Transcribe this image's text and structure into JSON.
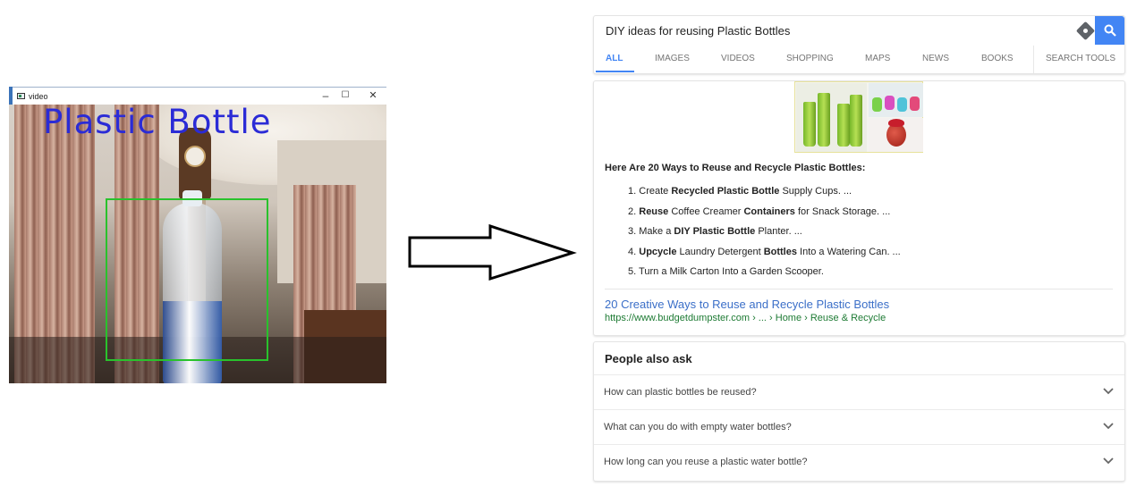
{
  "video_window": {
    "title": "video",
    "detection_label": "Plastic Bottle",
    "controls": {
      "minimize": "–",
      "maximize": "☐",
      "close": "✕"
    }
  },
  "search": {
    "query": "DIY ideas for reusing Plastic Bottles",
    "tabs": [
      {
        "label": "ALL",
        "active": true
      },
      {
        "label": "IMAGES"
      },
      {
        "label": "VIDEOS"
      },
      {
        "label": "SHOPPING"
      },
      {
        "label": "MAPS"
      },
      {
        "label": "NEWS"
      },
      {
        "label": "BOOKS"
      },
      {
        "label": "SEARCH TOOLS"
      }
    ]
  },
  "answer": {
    "heading": "Here Are 20 Ways to Reuse and Recycle Plastic Bottles:",
    "items": [
      {
        "n": "1.",
        "parts": [
          "Create ",
          "Recycled Plastic Bottle",
          " Supply Cups. ..."
        ]
      },
      {
        "n": "2.",
        "parts": [
          "",
          "Reuse",
          " Coffee Creamer ",
          "Containers",
          " for Snack Storage. ..."
        ]
      },
      {
        "n": "3.",
        "parts": [
          "Make a ",
          "DIY Plastic Bottle",
          " Planter. ..."
        ]
      },
      {
        "n": "4.",
        "parts": [
          "",
          "Upcycle",
          " Laundry Detergent ",
          "Bottles",
          " Into a Watering Can. ..."
        ]
      },
      {
        "n": "5.",
        "parts": [
          "Turn a Milk Carton Into a Garden Scooper."
        ]
      }
    ],
    "result_title": "20 Creative Ways to Reuse and Recycle Plastic Bottles",
    "result_url": "https://www.budgetdumpster.com › ... › Home › Reuse & Recycle"
  },
  "people_also_ask": {
    "title": "People also ask",
    "questions": [
      "How can plastic bottles be reused?",
      "What can you do with empty water bottles?",
      "How long can you reuse a plastic water bottle?"
    ]
  },
  "colors": {
    "accent": "#4285f4",
    "link": "#3b6fc8",
    "url": "#1e7b34",
    "detection_box": "#29c22c",
    "detection_text": "#2b2bd6"
  }
}
